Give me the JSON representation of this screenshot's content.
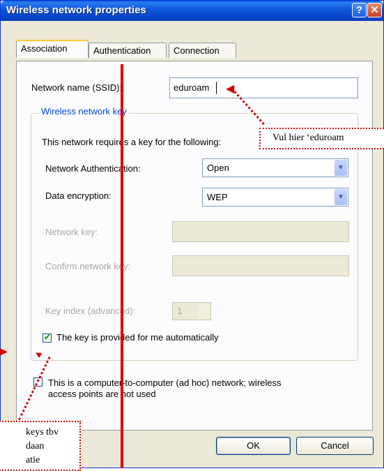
{
  "window": {
    "title": "Wireless network properties",
    "help_btn": "?",
    "close_btn": "✕"
  },
  "tabs": [
    {
      "label": "Association",
      "active": true
    },
    {
      "label": "Authentication",
      "active": false
    },
    {
      "label": "Connection",
      "active": false
    }
  ],
  "association": {
    "ssid_label": "Network name (SSID):",
    "ssid_value": "eduroam",
    "group_title": "Wireless network key",
    "group_desc": "This network requires a key for the following:",
    "auth_label": "Network Authentication:",
    "auth_value": "Open",
    "encryption_label": "Data encryption:",
    "encryption_value": "WEP",
    "network_key_label": "Network key:",
    "confirm_key_label": "Confirm network key:",
    "key_index_label": "Key index (advanced):",
    "key_index_value": "1",
    "auto_key_label": "The key is provided for me automatically",
    "auto_key_checked": true,
    "adhoc_label_1": "This is a computer-to-computer (ad hoc) network; wireless",
    "adhoc_label_2": "access points are not used",
    "adhoc_checked": false
  },
  "buttons": {
    "ok": "OK",
    "cancel": "Cancel"
  },
  "annotations": {
    "ssid_note": "Vul hier ‘eduroam",
    "key_note_1": "keys  tbv",
    "key_note_2": "daan",
    "key_note_3": "atie"
  },
  "colors": {
    "annotation": "#d40000",
    "titlebar": "#0a54d8"
  }
}
